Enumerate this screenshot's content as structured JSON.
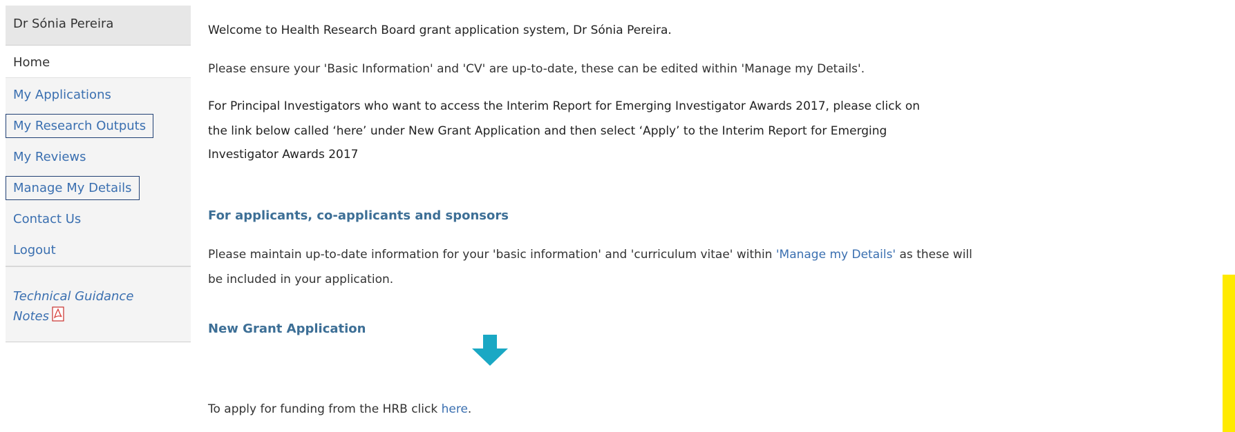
{
  "sidebar": {
    "user_name": "Dr Sónia Pereira",
    "home": "Home",
    "items": [
      {
        "label": "My Applications"
      },
      {
        "label": "My Research Outputs"
      },
      {
        "label": "My Reviews"
      },
      {
        "label": "Manage My Details"
      },
      {
        "label": "Contact Us"
      },
      {
        "label": "Logout"
      }
    ],
    "guidance_line1": "Technical Guidance",
    "guidance_line2": "Notes",
    "guidance_icon": "pdf-icon"
  },
  "main": {
    "welcome": "Welcome to Health Research Board grant application system, Dr Sónia Pereira.",
    "ensure": "Please ensure your 'Basic Information' and 'CV' are up-to-date, these can be edited within 'Manage my Details'.",
    "pi_line1": "For Principal Investigators who want to access the Interim Report for Emerging Investigator Awards 2017, please click on",
    "pi_line2": "the link below called ‘here’ under New Grant Application and then select ‘Apply’ to the Interim Report for Emerging",
    "pi_line3": "Investigator Awards 2017",
    "section1_title": "For applicants, co-applicants and sponsors",
    "maintain_before": "Please maintain up-to-date information for your 'basic information' and 'curriculum vitae' within ",
    "maintain_link": "'Manage my Details'",
    "maintain_after": " as these will",
    "maintain_line2": "be included in your application.",
    "section2_title": "New Grant Application",
    "apply_before": "To apply for funding from the HRB click ",
    "apply_link": "here",
    "apply_after": "."
  },
  "colors": {
    "link": "#3a6fb0",
    "section_title": "#3d6f96",
    "arrow": "#1aa8c4",
    "highlight_box": "#1f3f73",
    "yellow_bar": "#ffea00"
  }
}
